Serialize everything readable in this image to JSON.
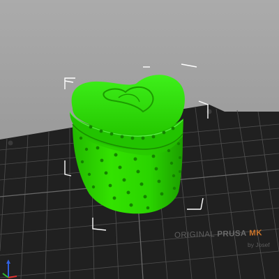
{
  "bed": {
    "brand_prefix": "ORIGINAL",
    "brand_name": "PRUSA",
    "brand_model": "MK",
    "sub_label": "by Josef"
  },
  "colors": {
    "background": "#a3a3a3",
    "bed_surface": "#1f1f1f",
    "bed_grid": "#5a5a5a",
    "model": "#2ed800",
    "model_shadow": "#1a8c00",
    "model_highlight": "#5cf04a",
    "selection_box": "#ffffff",
    "axis_x": "#e03030",
    "axis_y": "#30c030",
    "axis_z": "#3060e0"
  },
  "icons": {
    "axis_gizmo": "axis-gizmo-icon"
  }
}
